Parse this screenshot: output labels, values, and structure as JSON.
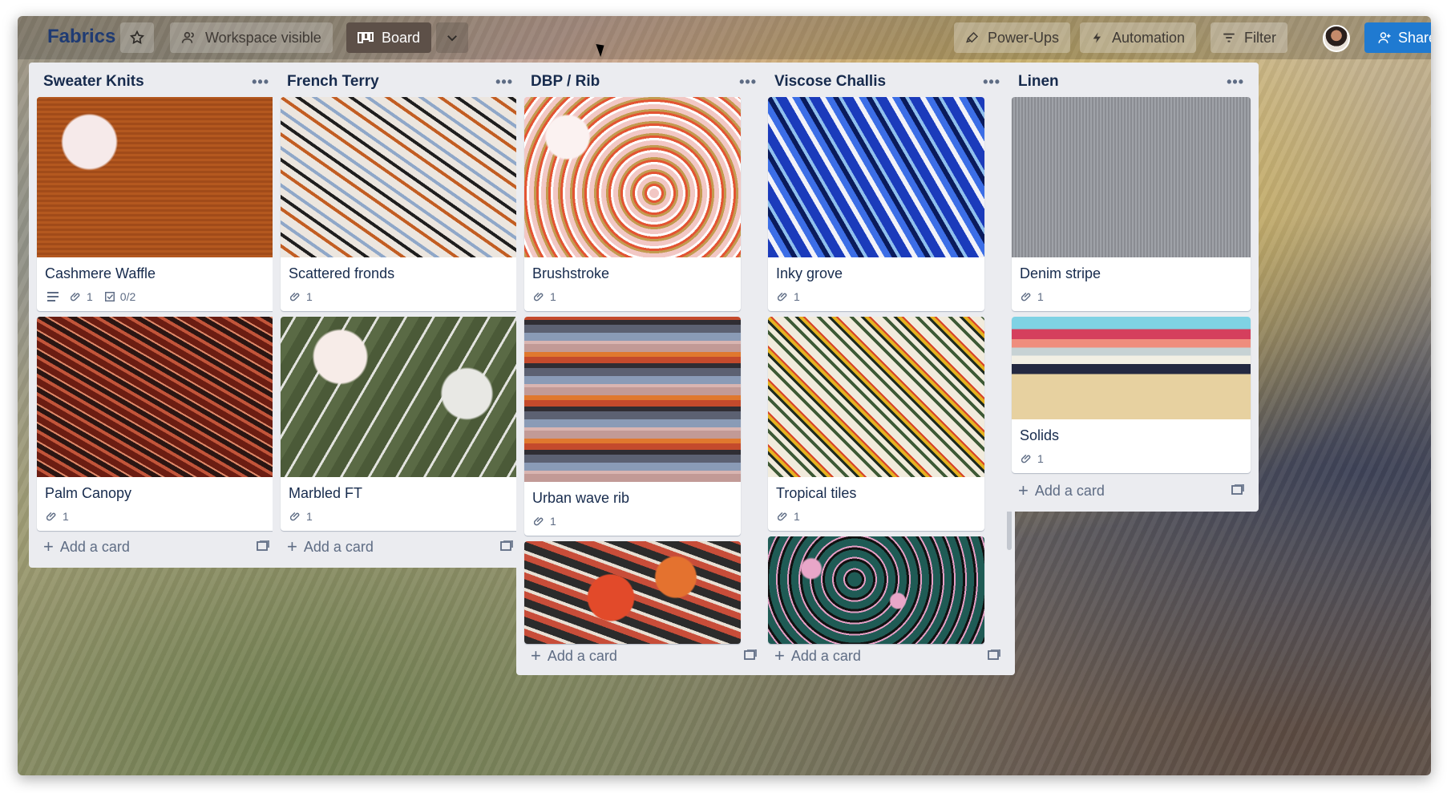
{
  "header": {
    "board_title": "Fabrics",
    "star_icon": "star-icon",
    "workspace_label": "Workspace visible",
    "board_label": "Board",
    "powerups_label": "Power-Ups",
    "automation_label": "Automation",
    "filter_label": "Filter",
    "share_label": "Share"
  },
  "lists": [
    {
      "title": "Sweater Knits",
      "add_card": "Add a card",
      "cards": [
        {
          "title": "Cashmere Waffle",
          "attachments": "1",
          "checklist": "0/2"
        },
        {
          "title": "Palm Canopy",
          "attachments": "1"
        }
      ]
    },
    {
      "title": "French Terry",
      "add_card": "Add a card",
      "cards": [
        {
          "title": "Scattered fronds",
          "attachments": "1"
        },
        {
          "title": "Marbled FT",
          "attachments": "1"
        }
      ]
    },
    {
      "title": "DBP / Rib",
      "add_card": "Add a card",
      "cards": [
        {
          "title": "Brushstroke",
          "attachments": "1"
        },
        {
          "title": "Urban wave rib",
          "attachments": "1"
        }
      ]
    },
    {
      "title": "Viscose Challis",
      "add_card": "Add a card",
      "cards": [
        {
          "title": "Inky grove",
          "attachments": "1"
        },
        {
          "title": "Tropical tiles",
          "attachments": "1"
        }
      ]
    },
    {
      "title": "Linen",
      "add_card": "Add a card",
      "cards": [
        {
          "title": "Denim stripe",
          "attachments": "1"
        },
        {
          "title": "Solids",
          "attachments": "1"
        }
      ]
    }
  ],
  "colors": {
    "list_bg": "#ebecf0",
    "share_button": "#1f7ad1",
    "board_button": "#5d5048",
    "title_blue": "#1f3b73"
  }
}
